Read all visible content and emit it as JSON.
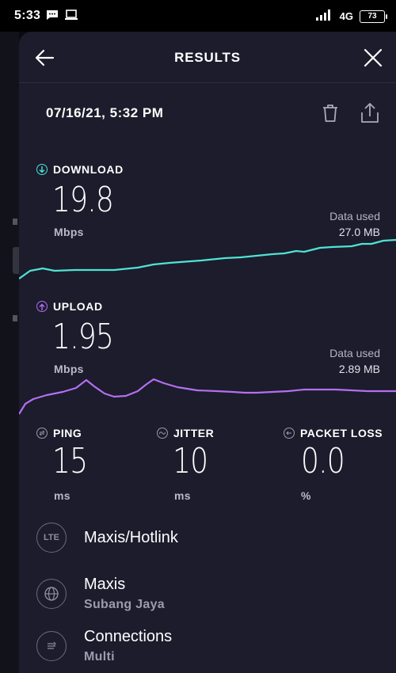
{
  "status_bar": {
    "time": "5:33",
    "network": "4G",
    "battery": "73",
    "icons": [
      "message-icon",
      "screen-icon",
      "signal-icon",
      "battery-icon"
    ]
  },
  "header": {
    "title": "RESULTS",
    "back_icon": "arrow-left-icon",
    "close_icon": "close-icon"
  },
  "result": {
    "datetime": "07/16/21, 5:32 PM",
    "actions": [
      "trash-icon",
      "share-icon"
    ]
  },
  "download": {
    "label": "DOWNLOAD",
    "value": "19.8",
    "unit": "Mbps",
    "data_used_label": "Data used",
    "data_used_value": "27.0 MB",
    "color": "#4fe3d6"
  },
  "upload": {
    "label": "UPLOAD",
    "value": "1.95",
    "unit": "Mbps",
    "data_used_label": "Data used",
    "data_used_value": "2.89 MB",
    "color": "#b46ff0"
  },
  "metrics": [
    {
      "label": "PING",
      "value": "15",
      "unit": "ms"
    },
    {
      "label": "JITTER",
      "value": "10",
      "unit": "ms"
    },
    {
      "label": "PACKET LOSS",
      "value": "0.0",
      "unit": "%"
    }
  ],
  "info": [
    {
      "icon": "lte-icon",
      "icon_text": "LTE",
      "main": "Maxis/Hotlink",
      "sub": ""
    },
    {
      "icon": "globe-icon",
      "main": "Maxis",
      "sub": "Subang Jaya"
    },
    {
      "icon": "connections-icon",
      "main": "Connections",
      "sub": "Multi"
    }
  ]
}
